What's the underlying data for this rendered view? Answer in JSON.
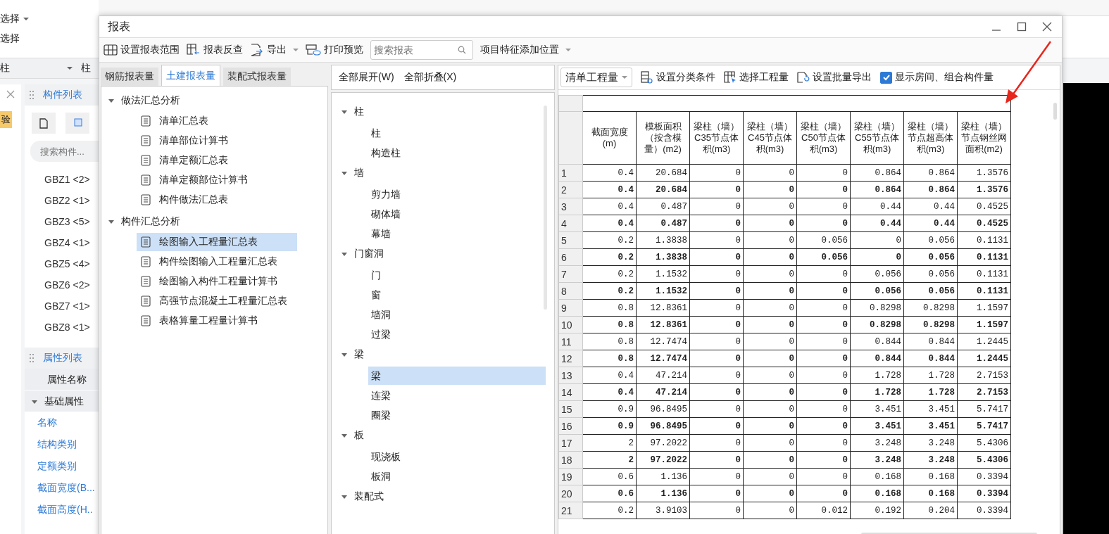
{
  "background_app": {
    "select_dropdown": "选择",
    "select_button": "选择",
    "filter_bar": {
      "dropdown": "柱",
      "label": "柱"
    },
    "side_badge": "验",
    "component_list": {
      "title": "构件列表",
      "search": {
        "placeholder": "搜索构件..."
      },
      "items": [
        "GBZ1 <2>",
        "GBZ2 <1>",
        "GBZ3 <5>",
        "GBZ4 <1>",
        "GBZ5 <4>",
        "GBZ6 <2>",
        "GBZ7 <1>",
        "GBZ8 <1>"
      ]
    },
    "property_list": {
      "title": "属性列表",
      "column": "属性名称",
      "group": {
        "label": "基础属性",
        "expanded": true
      },
      "properties": [
        "名称",
        "结构类别",
        "定额类别",
        "截面宽度(B...",
        "截面高度(H.."
      ]
    }
  },
  "dialog": {
    "title": "报表",
    "toolbar": [
      {
        "label": "设置报表范围",
        "kind": "button"
      },
      {
        "label": "报表反查",
        "kind": "button"
      },
      {
        "label": "导出",
        "kind": "menu"
      },
      {
        "label": "打印预览",
        "kind": "button"
      }
    ],
    "search": {
      "placeholder": "搜索报表"
    },
    "feature_position": "项目特征添加位置",
    "report_tabs": [
      {
        "label": "钢筋报表量",
        "selected": false
      },
      {
        "label": "土建报表量",
        "selected": true
      },
      {
        "label": "装配式报表量",
        "selected": false
      }
    ],
    "report_tree": [
      {
        "label": "做法汇总分析",
        "expanded": true,
        "children": [
          {
            "label": "清单汇总表",
            "selected": false
          },
          {
            "label": "清单部位计算书",
            "selected": false
          },
          {
            "label": "清单定额汇总表",
            "selected": false
          },
          {
            "label": "清单定额部位计算书",
            "selected": false
          },
          {
            "label": "构件做法汇总表",
            "selected": false
          }
        ]
      },
      {
        "label": "构件汇总分析",
        "expanded": true,
        "children": [
          {
            "label": "绘图输入工程量汇总表",
            "selected": true
          },
          {
            "label": "构件绘图输入工程量汇总表",
            "selected": false
          },
          {
            "label": "绘图输入构件工程量计算书",
            "selected": false
          },
          {
            "label": "高强节点混凝土工程量汇总表",
            "selected": false
          },
          {
            "label": "表格算量工程量计算书",
            "selected": false
          }
        ]
      }
    ],
    "tree_actions": [
      "全部展开(W)",
      "全部折叠(X)"
    ],
    "component_tree": [
      {
        "label": "柱",
        "expanded": true,
        "children": [
          {
            "label": "柱",
            "selected": false
          },
          {
            "label": "构造柱",
            "selected": false
          }
        ]
      },
      {
        "label": "墙",
        "expanded": true,
        "children": [
          {
            "label": "剪力墙",
            "selected": false
          },
          {
            "label": "砌体墙",
            "selected": false
          },
          {
            "label": "幕墙",
            "selected": false
          }
        ]
      },
      {
        "label": "门窗洞",
        "expanded": true,
        "children": [
          {
            "label": "门",
            "selected": false
          },
          {
            "label": "窗",
            "selected": false
          },
          {
            "label": "墙洞",
            "selected": false
          },
          {
            "label": "过梁",
            "selected": false
          }
        ]
      },
      {
        "label": "梁",
        "expanded": true,
        "children": [
          {
            "label": "梁",
            "selected": true
          },
          {
            "label": "连梁",
            "selected": false
          },
          {
            "label": "圈梁",
            "selected": false
          }
        ]
      },
      {
        "label": "板",
        "expanded": true,
        "children": [
          {
            "label": "现浇板",
            "selected": false
          },
          {
            "label": "板洞",
            "selected": false
          }
        ]
      },
      {
        "label": "装配式",
        "expanded": true
      }
    ],
    "table_toolbar": {
      "quantity_dropdown": "清单工程量",
      "buttons": [
        "设置分类条件",
        "选择工程量",
        "设置批量导出"
      ],
      "checkbox": {
        "label": "显示房间、组合构件量",
        "checked": true
      }
    },
    "table": {
      "columns": [
        "截面宽度(m)",
        "模板面积（按含模量）(m2)",
        "梁柱（墙）C35节点体积(m3)",
        "梁柱（墙）C45节点体积(m3)",
        "梁柱（墙）C50节点体积(m3)",
        "梁柱（墙）C55节点体积(m3)",
        "梁柱（墙）节点超高体积(m3)",
        "梁柱（墙）节点钢丝网面积(m2)"
      ],
      "rows": [
        {
          "number": "1",
          "bold": false,
          "cells": [
            "0.4",
            "20.684",
            "0",
            "0",
            "0",
            "0.864",
            "0.864",
            "1.3576"
          ]
        },
        {
          "number": "2",
          "bold": true,
          "cells": [
            "0.4",
            "20.684",
            "0",
            "0",
            "0",
            "0.864",
            "0.864",
            "1.3576"
          ]
        },
        {
          "number": "3",
          "bold": false,
          "cells": [
            "0.4",
            "0.487",
            "0",
            "0",
            "0",
            "0.44",
            "0.44",
            "0.4525"
          ]
        },
        {
          "number": "4",
          "bold": true,
          "cells": [
            "0.4",
            "0.487",
            "0",
            "0",
            "0",
            "0.44",
            "0.44",
            "0.4525"
          ]
        },
        {
          "number": "5",
          "bold": false,
          "cells": [
            "0.2",
            "1.3838",
            "0",
            "0",
            "0.056",
            "0",
            "0.056",
            "0.1131"
          ]
        },
        {
          "number": "6",
          "bold": true,
          "cells": [
            "0.2",
            "1.3838",
            "0",
            "0",
            "0.056",
            "0",
            "0.056",
            "0.1131"
          ]
        },
        {
          "number": "7",
          "bold": false,
          "cells": [
            "0.2",
            "1.1532",
            "0",
            "0",
            "0",
            "0.056",
            "0.056",
            "0.1131"
          ]
        },
        {
          "number": "8",
          "bold": true,
          "cells": [
            "0.2",
            "1.1532",
            "0",
            "0",
            "0",
            "0.056",
            "0.056",
            "0.1131"
          ]
        },
        {
          "number": "9",
          "bold": false,
          "cells": [
            "0.8",
            "12.8361",
            "0",
            "0",
            "0",
            "0.8298",
            "0.8298",
            "1.1597"
          ]
        },
        {
          "number": "10",
          "bold": true,
          "cells": [
            "0.8",
            "12.8361",
            "0",
            "0",
            "0",
            "0.8298",
            "0.8298",
            "1.1597"
          ]
        },
        {
          "number": "11",
          "bold": false,
          "cells": [
            "0.8",
            "12.7474",
            "0",
            "0",
            "0",
            "0.844",
            "0.844",
            "1.2445"
          ]
        },
        {
          "number": "12",
          "bold": true,
          "cells": [
            "0.8",
            "12.7474",
            "0",
            "0",
            "0",
            "0.844",
            "0.844",
            "1.2445"
          ]
        },
        {
          "number": "13",
          "bold": false,
          "cells": [
            "0.4",
            "47.214",
            "0",
            "0",
            "0",
            "1.728",
            "1.728",
            "2.7153"
          ]
        },
        {
          "number": "14",
          "bold": true,
          "cells": [
            "0.4",
            "47.214",
            "0",
            "0",
            "0",
            "1.728",
            "1.728",
            "2.7153"
          ]
        },
        {
          "number": "15",
          "bold": false,
          "cells": [
            "0.9",
            "96.8495",
            "0",
            "0",
            "0",
            "3.451",
            "3.451",
            "5.7417"
          ]
        },
        {
          "number": "16",
          "bold": true,
          "cells": [
            "0.9",
            "96.8495",
            "0",
            "0",
            "0",
            "3.451",
            "3.451",
            "5.7417"
          ]
        },
        {
          "number": "17",
          "bold": false,
          "cells": [
            "2",
            "97.2022",
            "0",
            "0",
            "0",
            "3.248",
            "3.248",
            "5.4306"
          ]
        },
        {
          "number": "18",
          "bold": true,
          "cells": [
            "2",
            "97.2022",
            "0",
            "0",
            "0",
            "3.248",
            "3.248",
            "5.4306"
          ]
        },
        {
          "number": "19",
          "bold": false,
          "cells": [
            "0.6",
            "1.136",
            "0",
            "0",
            "0",
            "0.168",
            "0.168",
            "0.3394"
          ]
        },
        {
          "number": "20",
          "bold": true,
          "cells": [
            "0.6",
            "1.136",
            "0",
            "0",
            "0",
            "0.168",
            "0.168",
            "0.3394"
          ]
        },
        {
          "number": "21",
          "bold": false,
          "cells": [
            "0.2",
            "3.9103",
            "0",
            "0",
            "0.012",
            "0.192",
            "0.204",
            "0.3394"
          ]
        }
      ]
    }
  }
}
